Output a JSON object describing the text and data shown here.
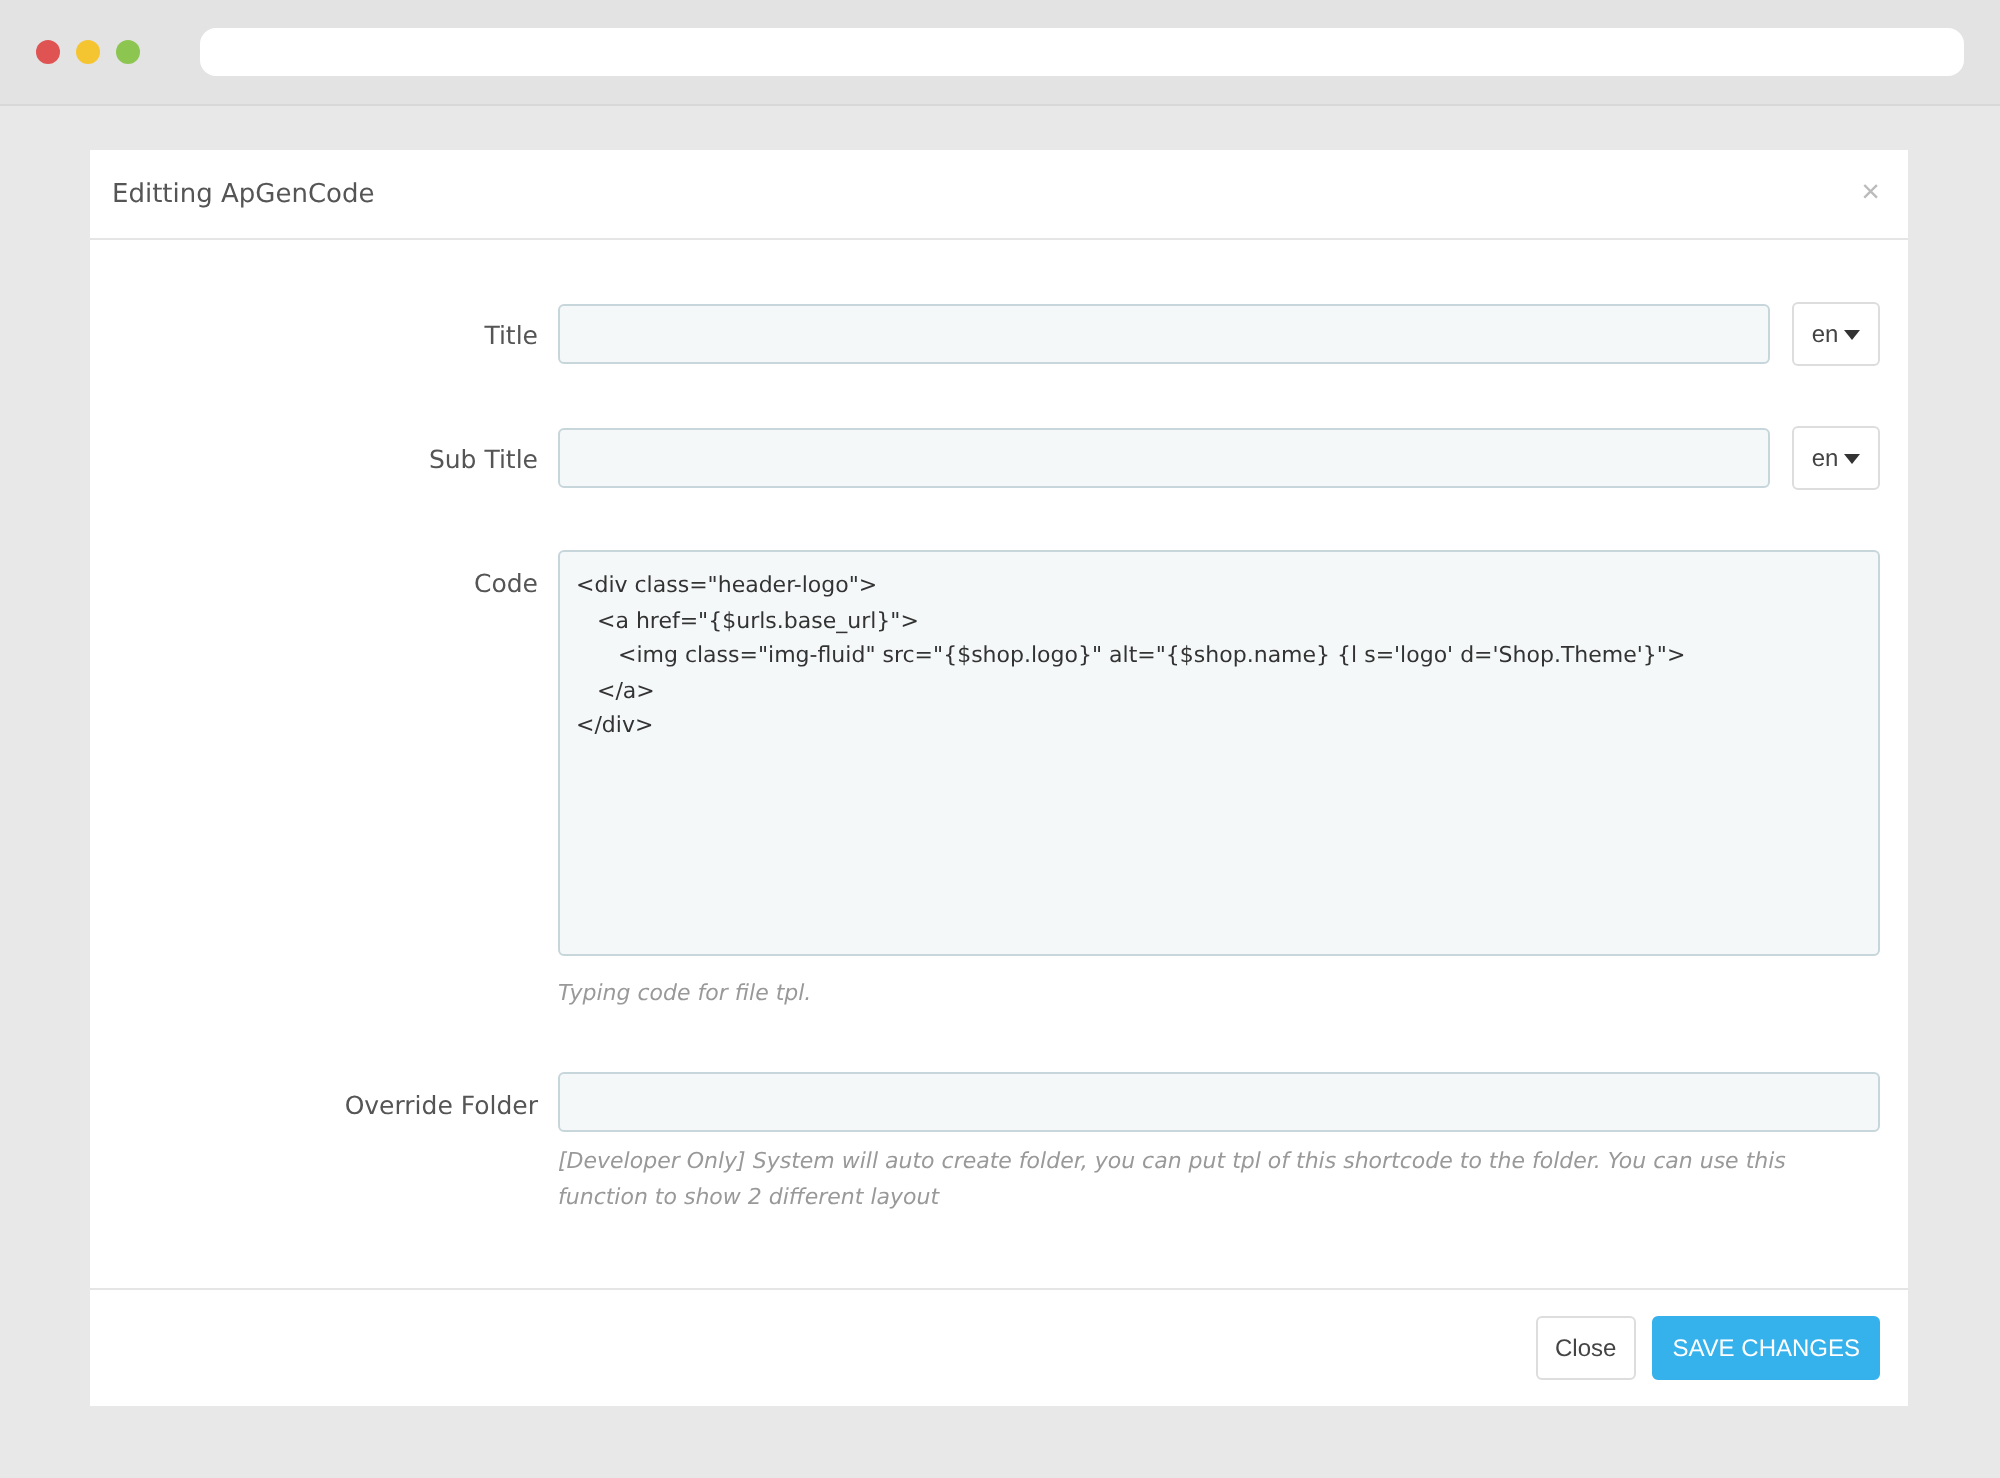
{
  "modal": {
    "title": "Editting ApGenCode",
    "close_icon": "×"
  },
  "fields": [
    {
      "kind": "text",
      "label": "Title",
      "lang": "en"
    },
    {
      "kind": "text",
      "label": "Sub Title",
      "lang": "en"
    },
    {
      "kind": "code",
      "label": "Code",
      "value": "<div class=\"header-logo\">\n   <a href=\"{$urls.base_url}\">\n      <img class=\"img-fluid\" src=\"{$shop.logo}\" alt=\"{$shop.name} {l s='logo' d='Shop.Theme'}\">\n   </a>\n</div>",
      "help": "Typing code for file tpl."
    },
    {
      "kind": "text",
      "label": "Override Folder",
      "help": "[Developer Only] System will auto create folder, you can put tpl of this shortcode to the folder. You can use this function to show 2 different layout"
    }
  ],
  "buttons": [
    {
      "label": "Close",
      "kind": "default"
    },
    {
      "label": "SAVE CHANGES",
      "kind": "primary"
    }
  ]
}
